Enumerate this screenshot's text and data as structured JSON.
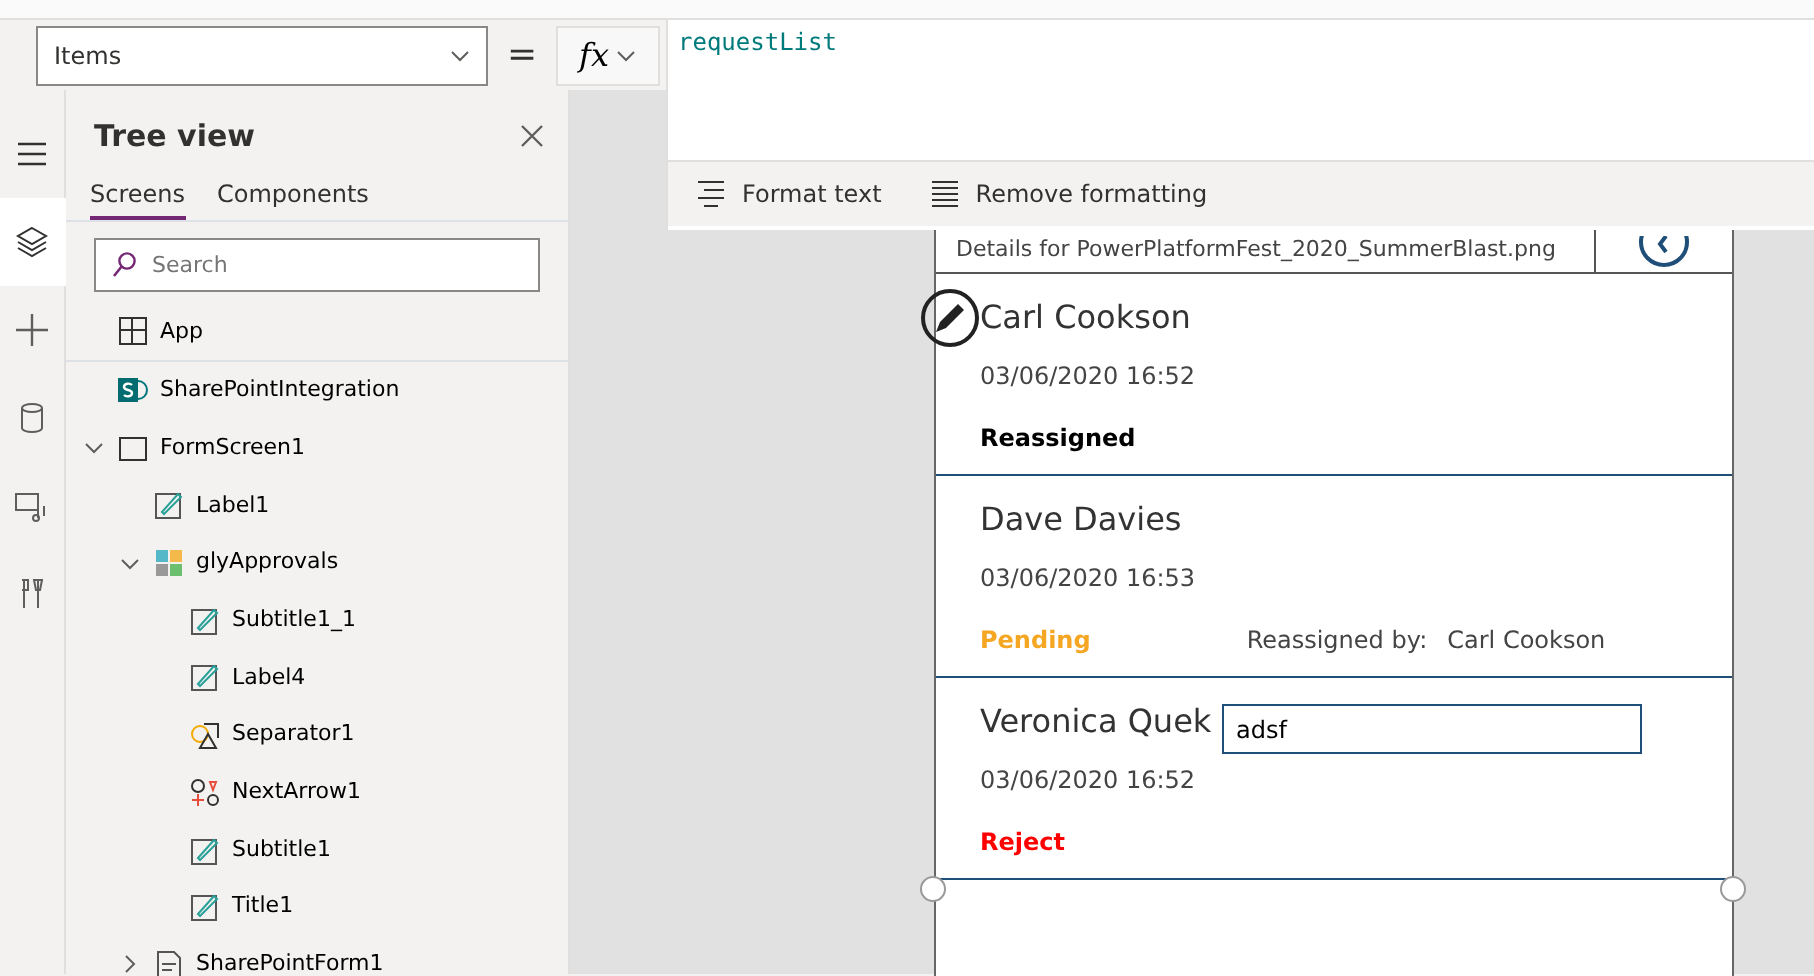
{
  "formula_bar": {
    "property": "Items",
    "equals": "=",
    "fx": "fx",
    "formula": "requestList",
    "actions": [
      {
        "kind": "format",
        "label": "Format text"
      },
      {
        "kind": "remove",
        "label": "Remove formatting"
      }
    ]
  },
  "rail": [
    {
      "kind": "menu",
      "selected": false
    },
    {
      "kind": "layers",
      "selected": true
    },
    {
      "kind": "plus",
      "selected": false
    },
    {
      "kind": "data",
      "selected": false
    },
    {
      "kind": "media",
      "selected": false
    },
    {
      "kind": "tools",
      "selected": false
    }
  ],
  "tree_view": {
    "title": "Tree view",
    "tabs": [
      {
        "label": "Screens",
        "selected": true
      },
      {
        "label": "Components",
        "selected": false
      }
    ],
    "search": {
      "placeholder": "Search"
    },
    "app": {
      "kind": "app",
      "label": "App"
    },
    "items": [
      {
        "kind": "sharepoint",
        "label": "SharePointIntegration"
      },
      {
        "kind": "screen",
        "label": "FormScreen1",
        "expanded": true,
        "children": [
          {
            "kind": "label",
            "label": "Label1"
          },
          {
            "kind": "gallery",
            "label": "glyApprovals",
            "expanded": true,
            "children": [
              {
                "kind": "label",
                "label": "Subtitle1_1"
              },
              {
                "kind": "label",
                "label": "Label4"
              },
              {
                "kind": "shape",
                "label": "Separator1"
              },
              {
                "kind": "icons",
                "label": "NextArrow1"
              },
              {
                "kind": "label",
                "label": "Subtitle1"
              },
              {
                "kind": "label",
                "label": "Title1"
              }
            ]
          },
          {
            "kind": "form",
            "label": "SharePointForm1",
            "expanded": false
          }
        ]
      }
    ]
  },
  "gallery": {
    "header": "Details for PowerPlatformFest_2020_SummerBlast.png",
    "items": [
      {
        "name": "Carl Cookson",
        "time": "03/06/2020 16:52",
        "status": "Reassigned",
        "color": "#000000"
      },
      {
        "name": "Dave Davies",
        "time": "03/06/2020 16:53",
        "status": "Pending",
        "color": "#f5a623",
        "reassigned_label": "Reassigned by:",
        "reassigned_by": "Carl Cookson"
      },
      {
        "name": "Veronica Quek",
        "time": "03/06/2020 16:52",
        "status": "Reject",
        "color": "#ff0000",
        "comment": "adsf"
      }
    ]
  }
}
